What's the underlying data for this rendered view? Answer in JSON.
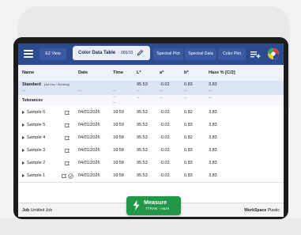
{
  "toolbar": {
    "tabs": [
      {
        "label": "EZ View"
      },
      {
        "label": "Color Data Table",
        "suffix": "· 065/10"
      },
      {
        "label": "Spectral Plot"
      },
      {
        "label": "Spectral Data"
      },
      {
        "label": "Color Plot"
      }
    ]
  },
  "table": {
    "columns": [
      "Name",
      "Date",
      "Time",
      "L*",
      "a*",
      "b*",
      "Haze % [C/2]"
    ],
    "standard": {
      "name": "Standard",
      "note": "(Ad Hoc / Working)",
      "L": "95.53",
      "a": "-0.02",
      "b": "0.83",
      "haze": "3.83"
    },
    "standard_dashes": [
      "--",
      "--",
      "--",
      "--",
      "--",
      "--",
      "--"
    ],
    "tolerances": {
      "name": "Tolerances",
      "cells": [
        "--",
        "--",
        "--",
        "--",
        "--",
        "--"
      ]
    },
    "rows": [
      {
        "name": "Sample 6",
        "date": "04/01/2026",
        "time": "18:59",
        "L": "95.53",
        "a": "-0.02",
        "b": "0.82",
        "haze": "3.83"
      },
      {
        "name": "Sample 5",
        "date": "04/01/2026",
        "time": "18:59",
        "L": "95.53",
        "a": "-0.02",
        "b": "0.83",
        "haze": "3.83"
      },
      {
        "name": "Sample 4",
        "date": "04/01/2026",
        "time": "18:58",
        "L": "95.53",
        "a": "-0.02",
        "b": "0.82",
        "haze": "3.83"
      },
      {
        "name": "Sample 3",
        "date": "04/01/2026",
        "time": "18:58",
        "L": "95.53",
        "a": "-0.02",
        "b": "0.83",
        "haze": "3.83"
      },
      {
        "name": "Sample 2",
        "date": "04/01/2026",
        "time": "18:58",
        "L": "95.53",
        "a": "-0.02",
        "b": "0.83",
        "haze": "3.83"
      },
      {
        "name": "Sample 1",
        "date": "04/01/2026",
        "time": "18:58",
        "L": "95.53",
        "a": "-0.02",
        "b": "0.83",
        "haze": "3.83"
      }
    ]
  },
  "measure": {
    "label": "Measure",
    "sub": "TTRAN - Haze"
  },
  "footer": {
    "job_label": "Job",
    "job_value": "Untitled Job",
    "workspace_label": "WorkSpace",
    "workspace_value": "Plastic"
  },
  "colors": {
    "accent": "#2d4c8f",
    "measure": "#22974a",
    "header_row": "#dbe5f6"
  }
}
